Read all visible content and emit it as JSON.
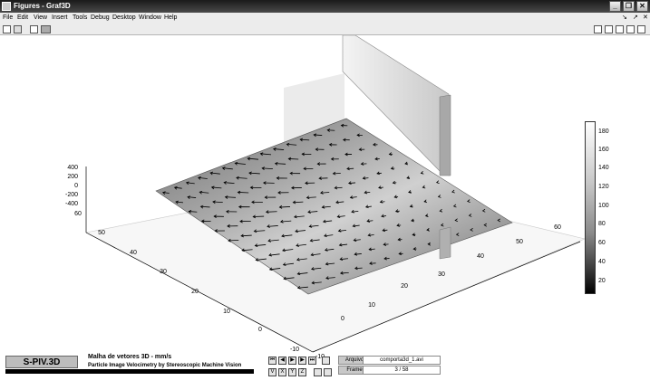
{
  "window": {
    "title": "Figures - Graf3D",
    "buttons": [
      "_",
      "❐",
      "✕"
    ]
  },
  "menu": {
    "items": [
      "File",
      "Edit",
      "View",
      "Insert",
      "Tools",
      "Debug",
      "Desktop",
      "Window",
      "Help"
    ],
    "right": [
      "↘",
      "↗",
      "✕"
    ]
  },
  "axes": {
    "z_ticks": [
      "400",
      "200",
      "0",
      "-200",
      "-400"
    ],
    "y_ticks": [
      "60",
      "50",
      "40",
      "30",
      "20",
      "10",
      "0",
      "-10"
    ],
    "x_ticks": [
      "-10",
      "0",
      "10",
      "20",
      "30",
      "40",
      "50",
      "60"
    ]
  },
  "colorbar": {
    "ticks": [
      "180",
      "160",
      "140",
      "120",
      "100",
      "80",
      "60",
      "40",
      "20"
    ]
  },
  "footer": {
    "logo": "S-PIV.3D",
    "heading": "Malha de vetores 3D  - mm/s",
    "subheading": "Particle Image Velocimetry by Stereoscopic Machine Vision",
    "nav_top": [
      "⏮",
      "◀",
      "▶",
      "▶",
      "⏭"
    ],
    "nav_bottom": [
      "V",
      "X",
      "Y",
      "Z"
    ],
    "file_label": "Arquivo",
    "file_value": "comporta3d_1.avi",
    "frame_label": "Frame",
    "frame_value": "3 / 58"
  }
}
